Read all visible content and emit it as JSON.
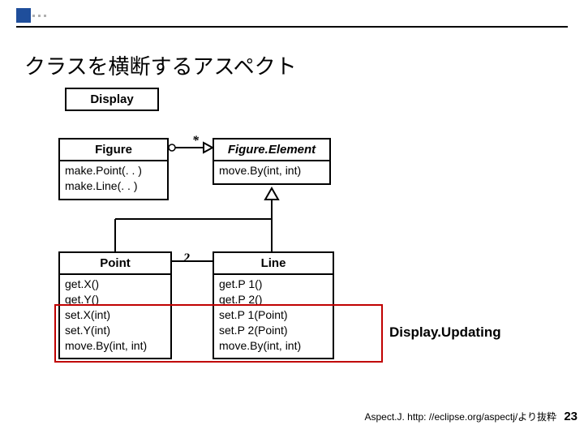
{
  "title": "クラスを横断するアスペクト",
  "display": {
    "name": "Display"
  },
  "figure": {
    "name": "Figure",
    "methods": [
      "make.Point(. . )",
      "make.Line(. . )"
    ]
  },
  "figureElement": {
    "name": "Figure.Element",
    "italic": true,
    "methods": [
      "move.By(int, int)"
    ]
  },
  "point": {
    "name": "Point",
    "methods": [
      "get.X()",
      "get.Y()",
      "set.X(int)",
      "set.Y(int)",
      "move.By(int, int)"
    ]
  },
  "line": {
    "name": "Line",
    "methods": [
      "get.P 1()",
      "get.P 2()",
      "set.P 1(Point)",
      "set.P 2(Point)",
      "move.By(int, int)"
    ]
  },
  "mult": {
    "star": "*",
    "two": "2"
  },
  "aspectLabel": "Display.Updating",
  "source": "Aspect.J. http: //eclipse.org/aspectj/より抜粋",
  "pagenum": "23"
}
